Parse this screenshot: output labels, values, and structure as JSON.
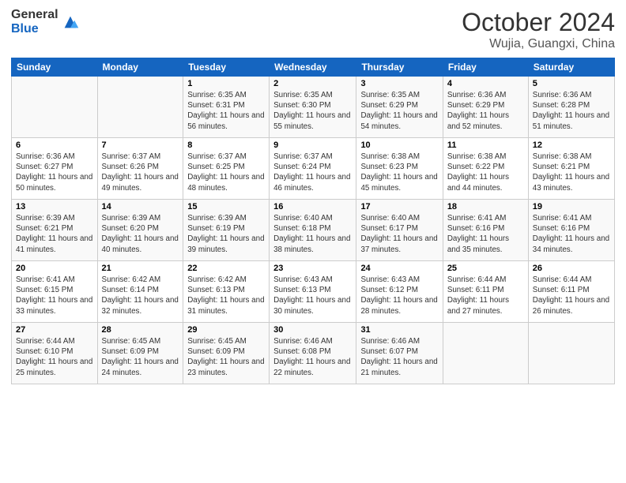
{
  "logo": {
    "general": "General",
    "blue": "Blue"
  },
  "header": {
    "title": "October 2024",
    "location": "Wujia, Guangxi, China"
  },
  "days_of_week": [
    "Sunday",
    "Monday",
    "Tuesday",
    "Wednesday",
    "Thursday",
    "Friday",
    "Saturday"
  ],
  "weeks": [
    [
      {
        "day": "",
        "sunrise": "",
        "sunset": "",
        "daylight": ""
      },
      {
        "day": "",
        "sunrise": "",
        "sunset": "",
        "daylight": ""
      },
      {
        "day": "1",
        "sunrise": "Sunrise: 6:35 AM",
        "sunset": "Sunset: 6:31 PM",
        "daylight": "Daylight: 11 hours and 56 minutes."
      },
      {
        "day": "2",
        "sunrise": "Sunrise: 6:35 AM",
        "sunset": "Sunset: 6:30 PM",
        "daylight": "Daylight: 11 hours and 55 minutes."
      },
      {
        "day": "3",
        "sunrise": "Sunrise: 6:35 AM",
        "sunset": "Sunset: 6:29 PM",
        "daylight": "Daylight: 11 hours and 54 minutes."
      },
      {
        "day": "4",
        "sunrise": "Sunrise: 6:36 AM",
        "sunset": "Sunset: 6:29 PM",
        "daylight": "Daylight: 11 hours and 52 minutes."
      },
      {
        "day": "5",
        "sunrise": "Sunrise: 6:36 AM",
        "sunset": "Sunset: 6:28 PM",
        "daylight": "Daylight: 11 hours and 51 minutes."
      }
    ],
    [
      {
        "day": "6",
        "sunrise": "Sunrise: 6:36 AM",
        "sunset": "Sunset: 6:27 PM",
        "daylight": "Daylight: 11 hours and 50 minutes."
      },
      {
        "day": "7",
        "sunrise": "Sunrise: 6:37 AM",
        "sunset": "Sunset: 6:26 PM",
        "daylight": "Daylight: 11 hours and 49 minutes."
      },
      {
        "day": "8",
        "sunrise": "Sunrise: 6:37 AM",
        "sunset": "Sunset: 6:25 PM",
        "daylight": "Daylight: 11 hours and 48 minutes."
      },
      {
        "day": "9",
        "sunrise": "Sunrise: 6:37 AM",
        "sunset": "Sunset: 6:24 PM",
        "daylight": "Daylight: 11 hours and 46 minutes."
      },
      {
        "day": "10",
        "sunrise": "Sunrise: 6:38 AM",
        "sunset": "Sunset: 6:23 PM",
        "daylight": "Daylight: 11 hours and 45 minutes."
      },
      {
        "day": "11",
        "sunrise": "Sunrise: 6:38 AM",
        "sunset": "Sunset: 6:22 PM",
        "daylight": "Daylight: 11 hours and 44 minutes."
      },
      {
        "day": "12",
        "sunrise": "Sunrise: 6:38 AM",
        "sunset": "Sunset: 6:21 PM",
        "daylight": "Daylight: 11 hours and 43 minutes."
      }
    ],
    [
      {
        "day": "13",
        "sunrise": "Sunrise: 6:39 AM",
        "sunset": "Sunset: 6:21 PM",
        "daylight": "Daylight: 11 hours and 41 minutes."
      },
      {
        "day": "14",
        "sunrise": "Sunrise: 6:39 AM",
        "sunset": "Sunset: 6:20 PM",
        "daylight": "Daylight: 11 hours and 40 minutes."
      },
      {
        "day": "15",
        "sunrise": "Sunrise: 6:39 AM",
        "sunset": "Sunset: 6:19 PM",
        "daylight": "Daylight: 11 hours and 39 minutes."
      },
      {
        "day": "16",
        "sunrise": "Sunrise: 6:40 AM",
        "sunset": "Sunset: 6:18 PM",
        "daylight": "Daylight: 11 hours and 38 minutes."
      },
      {
        "day": "17",
        "sunrise": "Sunrise: 6:40 AM",
        "sunset": "Sunset: 6:17 PM",
        "daylight": "Daylight: 11 hours and 37 minutes."
      },
      {
        "day": "18",
        "sunrise": "Sunrise: 6:41 AM",
        "sunset": "Sunset: 6:16 PM",
        "daylight": "Daylight: 11 hours and 35 minutes."
      },
      {
        "day": "19",
        "sunrise": "Sunrise: 6:41 AM",
        "sunset": "Sunset: 6:16 PM",
        "daylight": "Daylight: 11 hours and 34 minutes."
      }
    ],
    [
      {
        "day": "20",
        "sunrise": "Sunrise: 6:41 AM",
        "sunset": "Sunset: 6:15 PM",
        "daylight": "Daylight: 11 hours and 33 minutes."
      },
      {
        "day": "21",
        "sunrise": "Sunrise: 6:42 AM",
        "sunset": "Sunset: 6:14 PM",
        "daylight": "Daylight: 11 hours and 32 minutes."
      },
      {
        "day": "22",
        "sunrise": "Sunrise: 6:42 AM",
        "sunset": "Sunset: 6:13 PM",
        "daylight": "Daylight: 11 hours and 31 minutes."
      },
      {
        "day": "23",
        "sunrise": "Sunrise: 6:43 AM",
        "sunset": "Sunset: 6:13 PM",
        "daylight": "Daylight: 11 hours and 30 minutes."
      },
      {
        "day": "24",
        "sunrise": "Sunrise: 6:43 AM",
        "sunset": "Sunset: 6:12 PM",
        "daylight": "Daylight: 11 hours and 28 minutes."
      },
      {
        "day": "25",
        "sunrise": "Sunrise: 6:44 AM",
        "sunset": "Sunset: 6:11 PM",
        "daylight": "Daylight: 11 hours and 27 minutes."
      },
      {
        "day": "26",
        "sunrise": "Sunrise: 6:44 AM",
        "sunset": "Sunset: 6:11 PM",
        "daylight": "Daylight: 11 hours and 26 minutes."
      }
    ],
    [
      {
        "day": "27",
        "sunrise": "Sunrise: 6:44 AM",
        "sunset": "Sunset: 6:10 PM",
        "daylight": "Daylight: 11 hours and 25 minutes."
      },
      {
        "day": "28",
        "sunrise": "Sunrise: 6:45 AM",
        "sunset": "Sunset: 6:09 PM",
        "daylight": "Daylight: 11 hours and 24 minutes."
      },
      {
        "day": "29",
        "sunrise": "Sunrise: 6:45 AM",
        "sunset": "Sunset: 6:09 PM",
        "daylight": "Daylight: 11 hours and 23 minutes."
      },
      {
        "day": "30",
        "sunrise": "Sunrise: 6:46 AM",
        "sunset": "Sunset: 6:08 PM",
        "daylight": "Daylight: 11 hours and 22 minutes."
      },
      {
        "day": "31",
        "sunrise": "Sunrise: 6:46 AM",
        "sunset": "Sunset: 6:07 PM",
        "daylight": "Daylight: 11 hours and 21 minutes."
      },
      {
        "day": "",
        "sunrise": "",
        "sunset": "",
        "daylight": ""
      },
      {
        "day": "",
        "sunrise": "",
        "sunset": "",
        "daylight": ""
      }
    ]
  ]
}
